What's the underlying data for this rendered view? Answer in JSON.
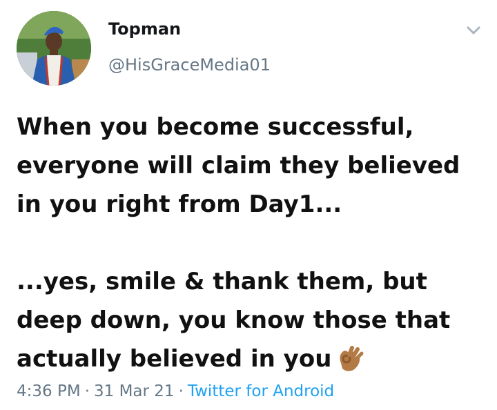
{
  "author": {
    "name": "Topman",
    "handle": "@HisGraceMedia01"
  },
  "tweet": {
    "paragraph1": "When you become successful, everyone will claim they believed in you right from Day1...",
    "paragraph2": "...yes, smile & thank them, but deep down, you know those that actually believed in you",
    "emoji": "ok-hand-emoji"
  },
  "meta": {
    "time": "4:36 PM",
    "separator": "·",
    "date": "31 Mar 21",
    "source": "Twitter for Android"
  },
  "icons": {
    "menu": "chevron-down-icon"
  },
  "colors": {
    "text": "#14171a",
    "muted": "#657786",
    "link": "#1da1f2"
  }
}
